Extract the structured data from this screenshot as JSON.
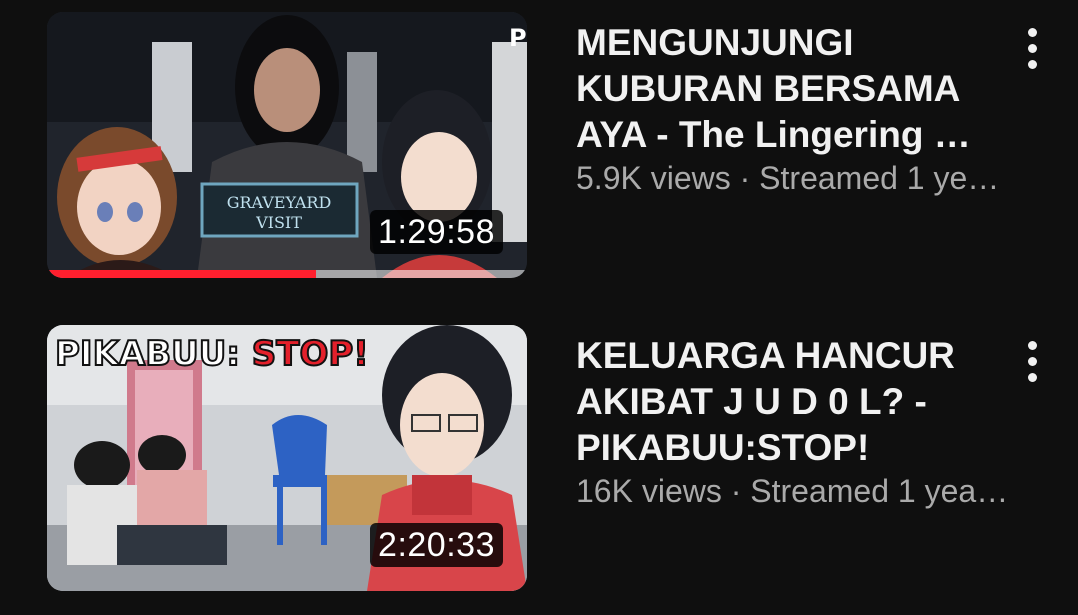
{
  "videos": [
    {
      "title": "MENGUNJUNGI KUBURAN BERSAMA AYA - The Lingering …",
      "views": "5.9K views",
      "separator": " · ",
      "streamed": "Streamed 1 ye…",
      "duration": "1:29:58",
      "thumbnail_text": "GRAVEYARD VISIT",
      "watch_progress": 0.56,
      "menu_icon": "more-vert-icon"
    },
    {
      "title": "KELUARGA HANCUR AKIBAT J U D 0 L? - PIKABUU:STOP!",
      "views": "16K views",
      "separator": " · ",
      "streamed": "Streamed 1 yea…",
      "duration": "2:20:33",
      "thumbnail_text_white": "PIKABUU: ",
      "thumbnail_text_red": "STOP!",
      "menu_icon": "more-vert-icon"
    }
  ],
  "colors": {
    "background": "#0f0f0f",
    "title": "#f1f1f1",
    "meta": "#aaaaaa",
    "progress": "#ff1f2e"
  }
}
